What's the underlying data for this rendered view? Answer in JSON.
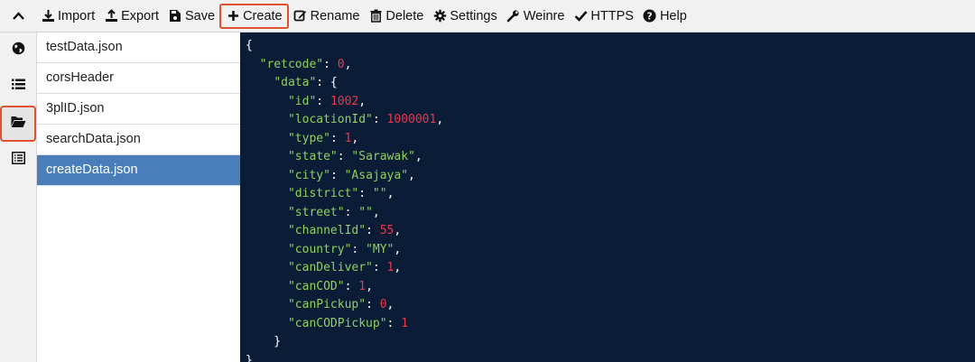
{
  "toolbar": {
    "import": "Import",
    "export": "Export",
    "save": "Save",
    "create": "Create",
    "rename": "Rename",
    "delete": "Delete",
    "settings": "Settings",
    "weinre": "Weinre",
    "https": "HTTPS",
    "help": "Help"
  },
  "files": [
    "testData.json",
    "corsHeader",
    "3plID.json",
    "searchData.json",
    "createData.json"
  ],
  "selected_file": "createData.json",
  "editor": {
    "lines": [
      [
        [
          "p",
          "{"
        ]
      ],
      [
        [
          "p",
          "  "
        ],
        [
          "k",
          "\"retcode\""
        ],
        [
          "p",
          ": "
        ],
        [
          "n",
          "0"
        ],
        [
          "p",
          ","
        ]
      ],
      [
        [
          "p",
          "    "
        ],
        [
          "k",
          "\"data\""
        ],
        [
          "p",
          ": {"
        ]
      ],
      [
        [
          "p",
          "      "
        ],
        [
          "k",
          "\"id\""
        ],
        [
          "p",
          ": "
        ],
        [
          "n",
          "1002"
        ],
        [
          "p",
          ","
        ]
      ],
      [
        [
          "p",
          "      "
        ],
        [
          "k",
          "\"locationId\""
        ],
        [
          "p",
          ": "
        ],
        [
          "n",
          "1000001"
        ],
        [
          "p",
          ","
        ]
      ],
      [
        [
          "p",
          "      "
        ],
        [
          "k",
          "\"type\""
        ],
        [
          "p",
          ": "
        ],
        [
          "n",
          "1"
        ],
        [
          "p",
          ","
        ]
      ],
      [
        [
          "p",
          "      "
        ],
        [
          "k",
          "\"state\""
        ],
        [
          "p",
          ": "
        ],
        [
          "s",
          "\"Sarawak\""
        ],
        [
          "p",
          ","
        ]
      ],
      [
        [
          "p",
          "      "
        ],
        [
          "k",
          "\"city\""
        ],
        [
          "p",
          ": "
        ],
        [
          "s",
          "\"Asajaya\""
        ],
        [
          "p",
          ","
        ]
      ],
      [
        [
          "p",
          "      "
        ],
        [
          "k",
          "\"district\""
        ],
        [
          "p",
          ": "
        ],
        [
          "s",
          "\"\""
        ],
        [
          "p",
          ","
        ]
      ],
      [
        [
          "p",
          "      "
        ],
        [
          "k",
          "\"street\""
        ],
        [
          "p",
          ": "
        ],
        [
          "s",
          "\"\""
        ],
        [
          "p",
          ","
        ]
      ],
      [
        [
          "p",
          "      "
        ],
        [
          "k",
          "\"channelId\""
        ],
        [
          "p",
          ": "
        ],
        [
          "n",
          "55"
        ],
        [
          "p",
          ","
        ]
      ],
      [
        [
          "p",
          "      "
        ],
        [
          "k",
          "\"country\""
        ],
        [
          "p",
          ": "
        ],
        [
          "s",
          "\"MY\""
        ],
        [
          "p",
          ","
        ]
      ],
      [
        [
          "p",
          "      "
        ],
        [
          "k",
          "\"canDeliver\""
        ],
        [
          "p",
          ": "
        ],
        [
          "n",
          "1"
        ],
        [
          "p",
          ","
        ]
      ],
      [
        [
          "p",
          "      "
        ],
        [
          "k",
          "\"canCOD\""
        ],
        [
          "p",
          ": "
        ],
        [
          "n",
          "1"
        ],
        [
          "p",
          ","
        ]
      ],
      [
        [
          "p",
          "      "
        ],
        [
          "k",
          "\"canPickup\""
        ],
        [
          "p",
          ": "
        ],
        [
          "n",
          "0"
        ],
        [
          "p",
          ","
        ]
      ],
      [
        [
          "p",
          "      "
        ],
        [
          "k",
          "\"canCODPickup\""
        ],
        [
          "p",
          ": "
        ],
        [
          "n",
          "1"
        ]
      ],
      [
        [
          "p",
          "    }"
        ]
      ],
      [
        [
          "p",
          "}"
        ]
      ]
    ]
  },
  "icons": {
    "collapse": "chevron-up-icon",
    "rail": [
      "globe-icon",
      "list-icon",
      "folder-open-icon",
      "table-list-icon"
    ],
    "toolbar": [
      "import-icon",
      "export-icon",
      "save-icon",
      "plus-icon",
      "edit-icon",
      "trash-icon",
      "gear-icon",
      "wrench-icon",
      "check-icon",
      "question-circle-icon"
    ]
  },
  "colors": {
    "editor_bg": "#0b1d36",
    "key_string": "#8fd061",
    "number": "#e8384f",
    "selected_row": "#4a7ebb",
    "highlight_border": "#e2512f"
  }
}
